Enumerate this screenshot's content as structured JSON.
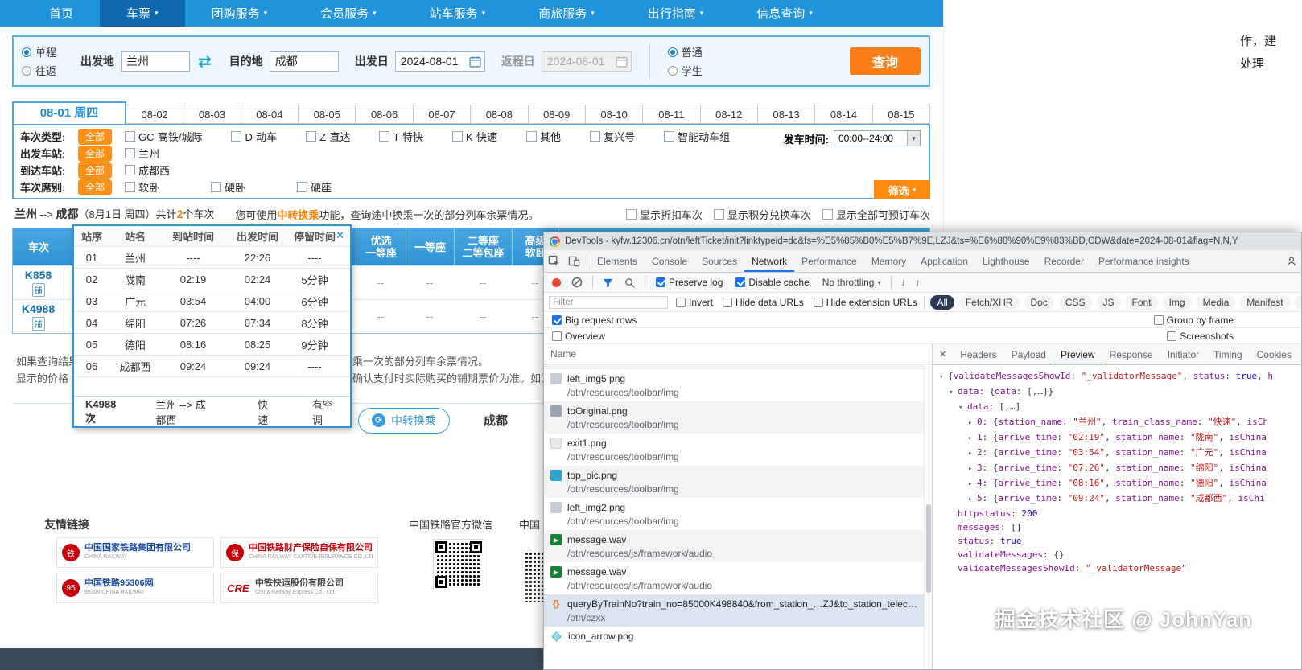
{
  "site": {
    "nav": [
      {
        "label": "首页",
        "caret": false,
        "active": false
      },
      {
        "label": "车票",
        "caret": true,
        "active": true
      },
      {
        "label": "团购服务",
        "caret": true,
        "active": false
      },
      {
        "label": "会员服务",
        "caret": true,
        "active": false
      },
      {
        "label": "站车服务",
        "caret": true,
        "active": false
      },
      {
        "label": "商旅服务",
        "caret": true,
        "active": false
      },
      {
        "label": "出行指南",
        "caret": true,
        "active": false
      },
      {
        "label": "信息查询",
        "caret": true,
        "active": false
      }
    ],
    "clipped_right_text": [
      "作，建",
      "处理"
    ],
    "search": {
      "trip_options": [
        {
          "label": "单程",
          "selected": true
        },
        {
          "label": "往返",
          "selected": false
        }
      ],
      "from_label": "出发地",
      "from_value": "兰州",
      "to_label": "目的地",
      "to_value": "成都",
      "depart_label": "出发日",
      "depart_value": "2024-08-01",
      "return_label": "返程日",
      "return_value": "2024-08-01",
      "passenger_options": [
        {
          "label": "普通",
          "selected": true
        },
        {
          "label": "学生",
          "selected": false
        }
      ],
      "query_button": "查询"
    },
    "date_tabs": {
      "active": "08-01 周四",
      "others": [
        "08-02",
        "08-03",
        "08-04",
        "08-05",
        "08-06",
        "08-07",
        "08-08",
        "08-09",
        "08-10",
        "08-11",
        "08-12",
        "08-13",
        "08-14",
        "08-15"
      ]
    },
    "filters": {
      "rows": [
        {
          "label": "车次类型:",
          "badge": "全部",
          "options": [
            "GC-高铁/城际",
            "D-动车",
            "Z-直达",
            "T-特快",
            "K-快速",
            "其他",
            "复兴号",
            "智能动车组"
          ]
        },
        {
          "label": "出发车站:",
          "badge": "全部",
          "options": [
            "兰州"
          ]
        },
        {
          "label": "到达车站:",
          "badge": "全部",
          "options": [
            "成都西"
          ]
        },
        {
          "label": "车次席别:",
          "badge": "全部",
          "options": [
            "软卧",
            "硬卧",
            "硬座"
          ]
        }
      ],
      "depart_time_label": "发车时间:",
      "depart_time_value": "00:00--24:00",
      "filter_button": "筛选"
    },
    "results": {
      "summary": {
        "from": "兰州",
        "arrow": " --> ",
        "to": "成都",
        "mid": "（8月1日 周四）共计",
        "count": "2",
        "tail": "个车次"
      },
      "tip_pre": "您可使用",
      "tip_link": "中转换乘",
      "tip_post": "功能，查询途中换乘一次的部分列车余票情况。",
      "display_checkboxes": [
        "显示折扣车次",
        "显示积分兑换车次",
        "显示全部可预订车次"
      ]
    },
    "train_table": {
      "col_train": "车次",
      "columns": [
        [
          "优选",
          "一等座"
        ],
        [
          "一等座",
          ""
        ],
        [
          "二等座",
          "二等包座"
        ],
        [
          "高级",
          "软卧"
        ]
      ],
      "rows": [
        {
          "train": "K858",
          "badge": "铺",
          "cells": [
            "--",
            "--",
            "--",
            "--"
          ]
        },
        {
          "train": "K4988",
          "badge": "铺",
          "cells": [
            "--",
            "--",
            "--",
            "--"
          ]
        }
      ]
    },
    "notes": {
      "left": [
        "如果查询结果",
        "显示的价格"
      ],
      "right": [
        "乘一次的部分列车余票情况。",
        "确认支付时实际购买的铺期票价为准。如因迟"
      ]
    },
    "transfer": {
      "button": "中转换乘",
      "city": "成都"
    },
    "footer": {
      "links_title": "友情链接",
      "wechat_title": "中国铁路官方微信",
      "extra_title": "中国",
      "partners": [
        {
          "name": "中国国家铁路集团有限公司",
          "sub": "CHINA RAILWAY",
          "style": "blue",
          "icon": "铁"
        },
        {
          "name": "中国铁路财产保险自保有限公司",
          "sub": "CHINA RAILWAY CAPTIVE INSURANCE CO.,LTD",
          "style": "red",
          "icon": "保"
        },
        {
          "name": "中国铁路95306网",
          "sub": "95306 CHINA RAILWAY",
          "style": "blue",
          "icon": "95"
        },
        {
          "name": "中铁快运股份有限公司",
          "sub": "China Railway Express Co., Ltd.",
          "style": "cre",
          "icon": "CRE"
        }
      ]
    }
  },
  "popup": {
    "headers": [
      "站序",
      "站名",
      "到站时间",
      "出发时间",
      "停留时间"
    ],
    "rows": [
      [
        "01",
        "兰州",
        "----",
        "22:26",
        "----"
      ],
      [
        "02",
        "陇南",
        "02:19",
        "02:24",
        "5分钟"
      ],
      [
        "03",
        "广元",
        "03:54",
        "04:00",
        "6分钟"
      ],
      [
        "04",
        "绵阳",
        "07:26",
        "07:34",
        "8分钟"
      ],
      [
        "05",
        "德阳",
        "08:16",
        "08:25",
        "9分钟"
      ],
      [
        "06",
        "成都西",
        "09:24",
        "09:24",
        "----"
      ]
    ],
    "footer": [
      "K4988次",
      "兰州 --> 成都西",
      "快速",
      "有空调"
    ]
  },
  "devtools": {
    "title": "DevTools - kyfw.12306.cn/otn/leftTicket/init?linktypeid=dc&fs=%E5%85%B0%E5%B7%9E,LZJ&ts=%E6%88%90%E9%83%BD,CDW&date=2024-08-01&flag=N,N,Y",
    "tabs": [
      "Elements",
      "Console",
      "Sources",
      "Network",
      "Performance",
      "Memory",
      "Application",
      "Lighthouse",
      "Recorder",
      "Performance insights"
    ],
    "active_tab": "Network",
    "controls": {
      "preserve_log": "Preserve log",
      "disable_cache": "Disable cache",
      "throttling": "No throttling"
    },
    "filter": {
      "placeholder": "Filter",
      "invert": "Invert",
      "hide_data": "Hide data URLs",
      "hide_ext": "Hide extension URLs"
    },
    "type_chips": [
      "All",
      "Fetch/XHR",
      "Doc",
      "CSS",
      "JS",
      "Font",
      "Img",
      "Media",
      "Manifest",
      "WS"
    ],
    "active_chip": "All",
    "options_row1_left": "Big request rows",
    "options_row1_right": "Group by frame",
    "options_row2_left": "Overview",
    "options_row2_right": "Screenshots",
    "name_header": "Name",
    "requests": [
      {
        "name": "left_img5.png",
        "path": "/otn/resources/toolbar/img",
        "icon": "img-gray",
        "selected": false
      },
      {
        "name": "toOriginal.png",
        "path": "/otn/resources/toolbar/img",
        "icon": "img-dark",
        "selected": false
      },
      {
        "name": "exit1.png",
        "path": "/otn/resources/toolbar/img",
        "icon": "img-light",
        "selected": false
      },
      {
        "name": "top_pic.png",
        "path": "/otn/resources/toolbar/img",
        "icon": "img-teal",
        "selected": false
      },
      {
        "name": "left_img2.png",
        "path": "/otn/resources/toolbar/img",
        "icon": "img-gray",
        "selected": false
      },
      {
        "name": "message.wav",
        "path": "/otn/resources/js/framework/audio",
        "icon": "media",
        "selected": false
      },
      {
        "name": "message.wav",
        "path": "/otn/resources/js/framework/audio",
        "icon": "media",
        "selected": false
      },
      {
        "name": "queryByTrainNo?train_no=85000K498840&from_station_…ZJ&to_station_telecode…",
        "path": "/otn/czxx",
        "icon": "xhr",
        "selected": true
      },
      {
        "name": "icon_arrow.png",
        "path": "",
        "icon": "img-diamond",
        "selected": false
      }
    ],
    "detail_tabs": [
      "Headers",
      "Payload",
      "Preview",
      "Response",
      "Initiator",
      "Timing",
      "Cookies"
    ],
    "active_detail_tab": "Preview",
    "preview": [
      {
        "indent": 0,
        "arrow": "open",
        "parts": [
          [
            "plain",
            "{"
          ],
          [
            "key",
            "validateMessagesShowId"
          ],
          [
            "plain",
            ": "
          ],
          [
            "str",
            "\"_validatorMessage\""
          ],
          [
            "plain",
            ", "
          ],
          [
            "key",
            "status"
          ],
          [
            "plain",
            ": "
          ],
          [
            "num",
            "true"
          ],
          [
            "plain",
            ", "
          ],
          [
            "key",
            "h"
          ]
        ]
      },
      {
        "indent": 1,
        "arrow": "open",
        "parts": [
          [
            "key",
            "data"
          ],
          [
            "plain",
            ": {"
          ],
          [
            "key",
            "data"
          ],
          [
            "plain",
            ": [,…]}"
          ]
        ]
      },
      {
        "indent": 2,
        "arrow": "open",
        "parts": [
          [
            "key",
            "data"
          ],
          [
            "plain",
            ": [,…]"
          ]
        ]
      },
      {
        "indent": 3,
        "arrow": "closed",
        "parts": [
          [
            "key",
            "0"
          ],
          [
            "plain",
            ": {"
          ],
          [
            "key",
            "station_name"
          ],
          [
            "plain",
            ": "
          ],
          [
            "str",
            "\"兰州\""
          ],
          [
            "plain",
            ", "
          ],
          [
            "key",
            "train_class_name"
          ],
          [
            "plain",
            ": "
          ],
          [
            "str",
            "\"快速\""
          ],
          [
            "plain",
            ", "
          ],
          [
            "key",
            "isCh"
          ]
        ]
      },
      {
        "indent": 3,
        "arrow": "closed",
        "parts": [
          [
            "key",
            "1"
          ],
          [
            "plain",
            ": {"
          ],
          [
            "key",
            "arrive_time"
          ],
          [
            "plain",
            ": "
          ],
          [
            "str",
            "\"02:19\""
          ],
          [
            "plain",
            ", "
          ],
          [
            "key",
            "station_name"
          ],
          [
            "plain",
            ": "
          ],
          [
            "str",
            "\"陇南\""
          ],
          [
            "plain",
            ", "
          ],
          [
            "key",
            "isChina"
          ]
        ]
      },
      {
        "indent": 3,
        "arrow": "closed",
        "parts": [
          [
            "key",
            "2"
          ],
          [
            "plain",
            ": {"
          ],
          [
            "key",
            "arrive_time"
          ],
          [
            "plain",
            ": "
          ],
          [
            "str",
            "\"03:54\""
          ],
          [
            "plain",
            ", "
          ],
          [
            "key",
            "station_name"
          ],
          [
            "plain",
            ": "
          ],
          [
            "str",
            "\"广元\""
          ],
          [
            "plain",
            ", "
          ],
          [
            "key",
            "isChina"
          ]
        ]
      },
      {
        "indent": 3,
        "arrow": "closed",
        "parts": [
          [
            "key",
            "3"
          ],
          [
            "plain",
            ": {"
          ],
          [
            "key",
            "arrive_time"
          ],
          [
            "plain",
            ": "
          ],
          [
            "str",
            "\"07:26\""
          ],
          [
            "plain",
            ", "
          ],
          [
            "key",
            "station_name"
          ],
          [
            "plain",
            ": "
          ],
          [
            "str",
            "\"绵阳\""
          ],
          [
            "plain",
            ", "
          ],
          [
            "key",
            "isChina"
          ]
        ]
      },
      {
        "indent": 3,
        "arrow": "closed",
        "parts": [
          [
            "key",
            "4"
          ],
          [
            "plain",
            ": {"
          ],
          [
            "key",
            "arrive_time"
          ],
          [
            "plain",
            ": "
          ],
          [
            "str",
            "\"08:16\""
          ],
          [
            "plain",
            ", "
          ],
          [
            "key",
            "station_name"
          ],
          [
            "plain",
            ": "
          ],
          [
            "str",
            "\"德阳\""
          ],
          [
            "plain",
            ", "
          ],
          [
            "key",
            "isChina"
          ]
        ]
      },
      {
        "indent": 3,
        "arrow": "closed",
        "parts": [
          [
            "key",
            "5"
          ],
          [
            "plain",
            ": {"
          ],
          [
            "key",
            "arrive_time"
          ],
          [
            "plain",
            ": "
          ],
          [
            "str",
            "\"09:24\""
          ],
          [
            "plain",
            ", "
          ],
          [
            "key",
            "station_name"
          ],
          [
            "plain",
            ": "
          ],
          [
            "str",
            "\"成都西\""
          ],
          [
            "plain",
            ", "
          ],
          [
            "key",
            "isChi"
          ]
        ]
      },
      {
        "indent": 1,
        "arrow": "none",
        "parts": [
          [
            "key",
            "httpstatus"
          ],
          [
            "plain",
            ": "
          ],
          [
            "num",
            "200"
          ]
        ]
      },
      {
        "indent": 1,
        "arrow": "none",
        "parts": [
          [
            "key",
            "messages"
          ],
          [
            "plain",
            ": []"
          ]
        ]
      },
      {
        "indent": 1,
        "arrow": "none",
        "parts": [
          [
            "key",
            "status"
          ],
          [
            "plain",
            ": "
          ],
          [
            "num",
            "true"
          ]
        ]
      },
      {
        "indent": 1,
        "arrow": "none",
        "parts": [
          [
            "key",
            "validateMessages"
          ],
          [
            "plain",
            ": {}"
          ]
        ]
      },
      {
        "indent": 1,
        "arrow": "none",
        "parts": [
          [
            "key",
            "validateMessagesShowId"
          ],
          [
            "plain",
            ": "
          ],
          [
            "str",
            "\"_validatorMessage\""
          ]
        ]
      }
    ]
  },
  "watermark": "掘金技术社区 @ JohnYan"
}
